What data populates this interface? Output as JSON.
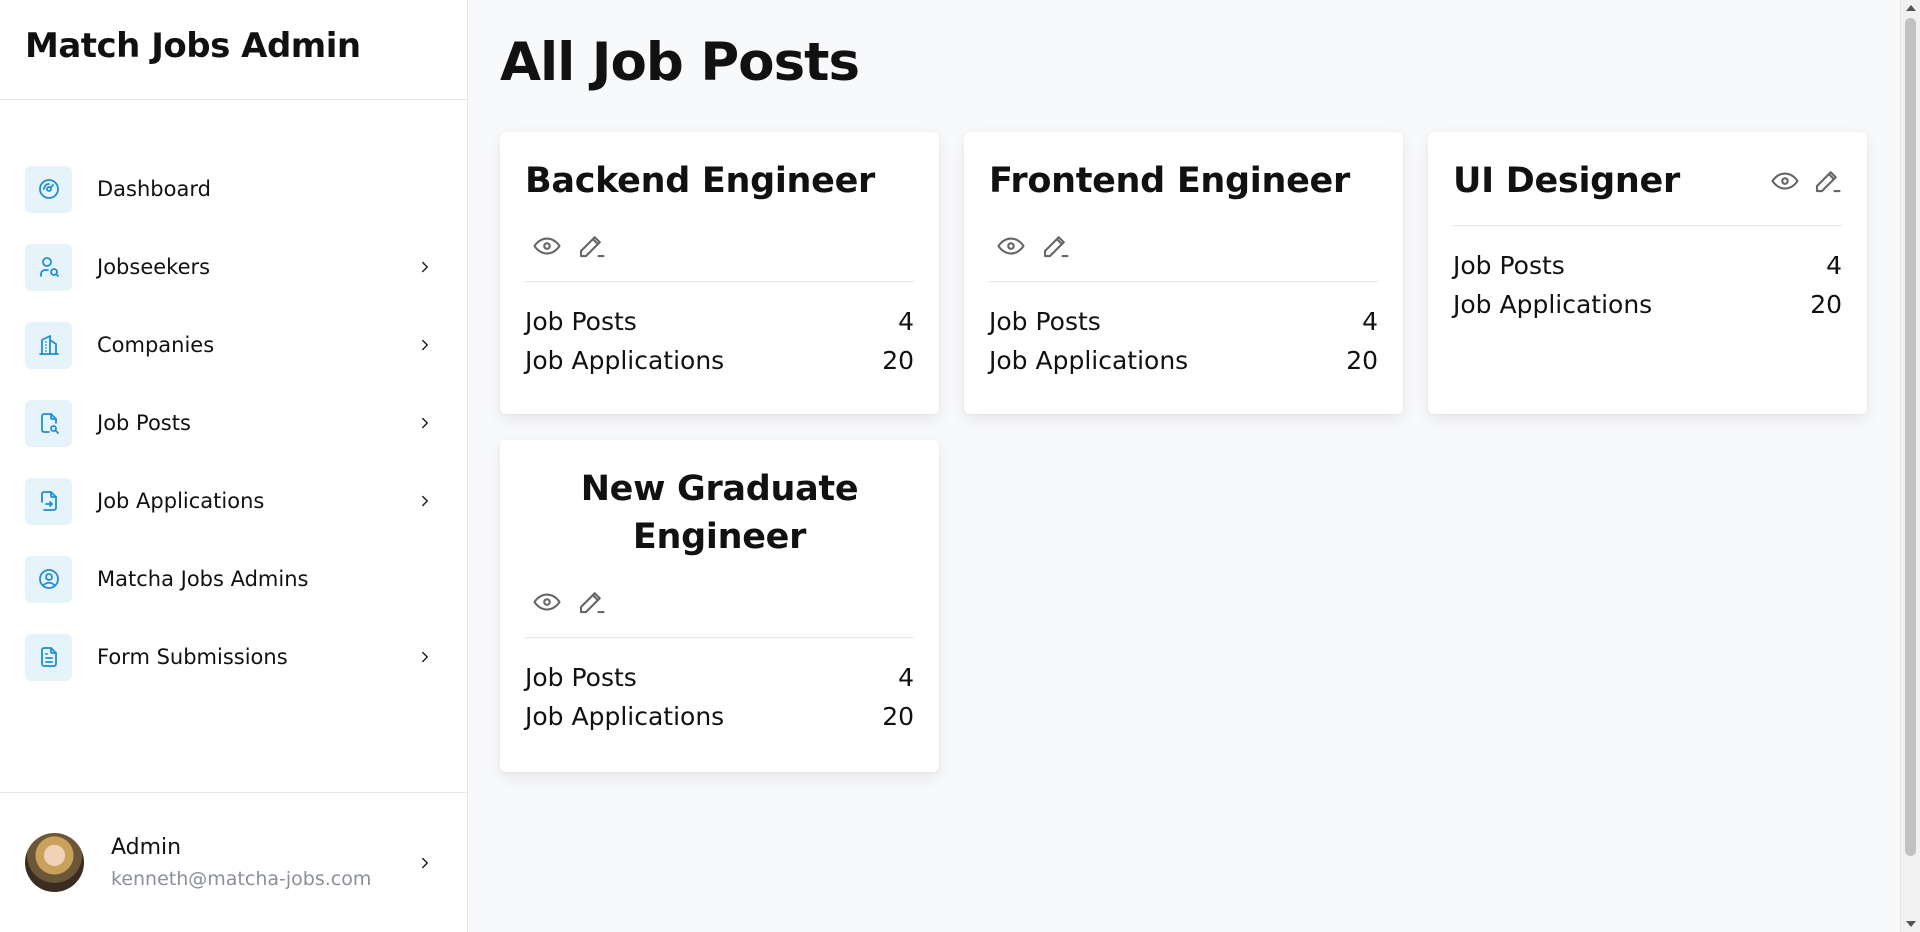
{
  "brand": "Match Jobs Admin",
  "nav": [
    {
      "label": "Dashboard",
      "icon": "dashboard-icon",
      "chevron": false
    },
    {
      "label": "Jobseekers",
      "icon": "user-search-icon",
      "chevron": true
    },
    {
      "label": "Companies",
      "icon": "building-icon",
      "chevron": true
    },
    {
      "label": "Job Posts",
      "icon": "file-search-icon",
      "chevron": true
    },
    {
      "label": "Job Applications",
      "icon": "file-import-icon",
      "chevron": true
    },
    {
      "label": "Matcha Jobs Admins",
      "icon": "user-circle-icon",
      "chevron": false
    },
    {
      "label": "Form Submissions",
      "icon": "file-text-icon",
      "chevron": true
    }
  ],
  "user": {
    "name": "Admin",
    "email": "kenneth@matcha-jobs.com"
  },
  "page_title": "All Job Posts",
  "stat_labels": {
    "posts": "Job Posts",
    "applications": "Job Applications"
  },
  "cards": [
    {
      "title": "Backend Engineer",
      "job_posts": "4",
      "job_applications": "20"
    },
    {
      "title": "Frontend Engineer",
      "job_posts": "4",
      "job_applications": "20"
    },
    {
      "title": "UI Designer",
      "job_posts": "4",
      "job_applications": "20"
    },
    {
      "title": "New Graduate Engineer",
      "job_posts": "4",
      "job_applications": "20"
    }
  ],
  "colors": {
    "accent": "#1e8fd0",
    "icon_bg": "#e7f3fb"
  }
}
